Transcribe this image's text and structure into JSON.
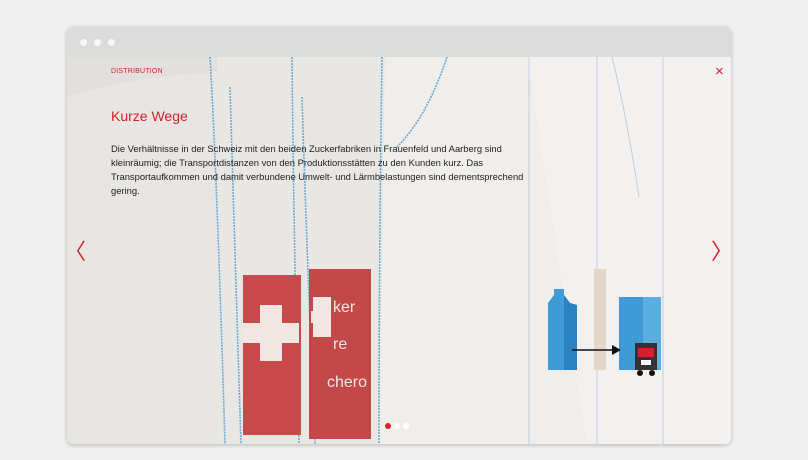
{
  "slide": {
    "section_label": "DISTRIBUTION",
    "title": "Kurze Wege",
    "body": "Die Verhältnisse in der Schweiz mit den beiden Zuckerfabriken in Frauenfeld und Aarberg sind kleinräumig; die Transportdistanzen von den Produktionsstätten zu den Kunden kurz. Das Transportaufkommen und damit verbundene Umwelt- und Lärmbelastungen sind dementsprechend gering."
  },
  "controls": {
    "close_icon": "×",
    "prev_icon": "〈",
    "next_icon": "〉"
  },
  "photo": {
    "bag_text": [
      "ker",
      "re",
      "chero"
    ]
  },
  "pagination": {
    "total": 3,
    "active": 1
  },
  "colors": {
    "accent": "#d6202d",
    "icon_blue": "#3f9ad6",
    "icon_beige": "#e4d6c8"
  },
  "icons": [
    "close-icon",
    "chevron-left-icon",
    "chevron-right-icon",
    "silo-icon",
    "truck-icon",
    "arrow-right-icon"
  ]
}
